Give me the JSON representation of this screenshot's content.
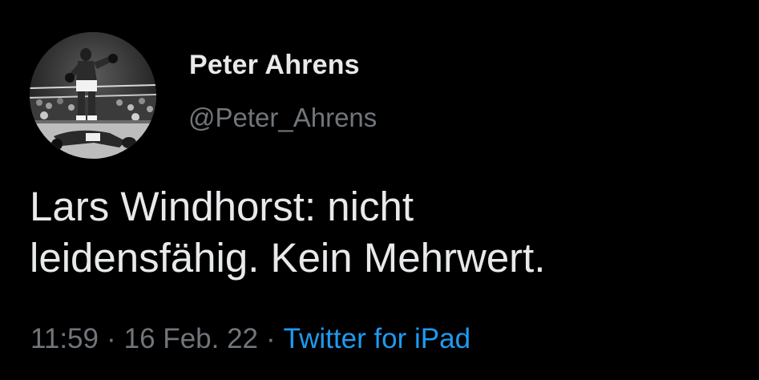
{
  "tweet": {
    "display_name": "Peter Ahrens",
    "handle": "@Peter_Ahrens",
    "text": "Lars Windhorst: nicht\nleidensfähig. Kein Mehrwert.",
    "time": "11:59",
    "date": "16 Feb. 22",
    "separator": "·",
    "source": "Twitter for iPad"
  },
  "colors": {
    "background": "#000000",
    "primary_text": "#e7e9ea",
    "secondary_text": "#71767b",
    "link": "#1d9bf0"
  },
  "icons": {
    "avatar": "boxing-photo-avatar"
  }
}
